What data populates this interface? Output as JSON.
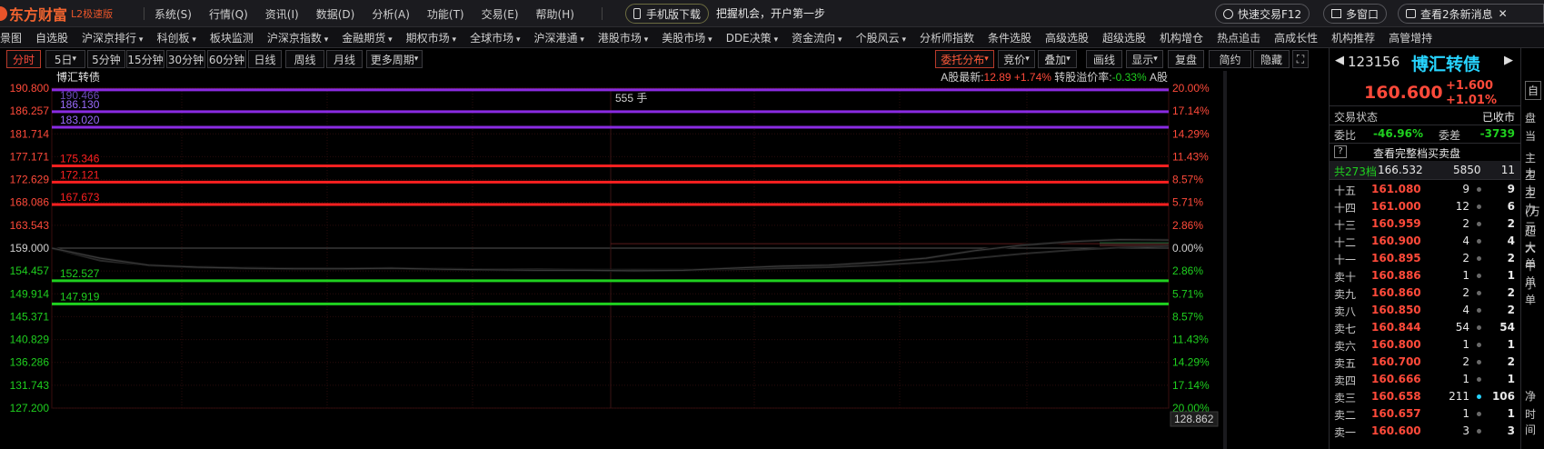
{
  "app": {
    "logo": "东方财富",
    "edition": "L2极速版",
    "menu": [
      "系统(S)",
      "行情(Q)",
      "资讯(I)",
      "数据(D)",
      "分析(A)",
      "功能(T)",
      "交易(E)",
      "帮助(H)"
    ],
    "mobile_download": "手机版下载",
    "promo": "把握机会，开户第一步",
    "fast_trade": "快速交易F12",
    "multi_window": "多窗口",
    "messages": "查看2条新消息"
  },
  "nav": [
    "景图",
    "自选股",
    "沪深京排行",
    "科创板",
    "板块监测",
    "沪深京指数",
    "金融期货",
    "期权市场",
    "全球市场",
    "沪深港通",
    "港股市场",
    "美股市场",
    "DDE决策",
    "资金流向",
    "个股风云",
    "分析师指数",
    "条件选股",
    "高级选股",
    "超级选股",
    "机构增仓",
    "热点追击",
    "高成长性",
    "机构推荐",
    "高管增持"
  ],
  "nav_dropdown": [
    false,
    false,
    true,
    true,
    false,
    true,
    true,
    true,
    true,
    true,
    true,
    true,
    true,
    true,
    true,
    false,
    false,
    false,
    false,
    false,
    false,
    false,
    false,
    false
  ],
  "toolbar": {
    "periods": [
      "分时",
      "5日",
      "5分钟",
      "15分钟",
      "30分钟",
      "60分钟",
      "日线",
      "周线",
      "月线",
      "更多周期"
    ],
    "right": [
      "委托分布",
      "竞价",
      "叠加",
      "画线",
      "显示",
      "复盘",
      "简约",
      "隐藏"
    ]
  },
  "chart_header": {
    "name": "博汇转债",
    "a_share_label": "A股最新:",
    "a_share_price": "12.89",
    "a_share_change": "+1.74%",
    "premium_label": "转股溢价率:",
    "premium": "-0.33%",
    "a_share_tag": "A股",
    "volume_note": "555 手",
    "corner_value": "128.862",
    "top_faded": "190.466"
  },
  "chart_data": {
    "type": "line",
    "ylim": [
      127.2,
      190.8
    ],
    "prev_close": 159.0,
    "y_ticks_left": [
      "190.800",
      "186.257",
      "181.714",
      "177.171",
      "172.629",
      "168.086",
      "163.543",
      "159.000",
      "154.457",
      "149.914",
      "145.371",
      "140.829",
      "136.286",
      "131.743",
      "127.200"
    ],
    "y_ticks_right": [
      "20.00%",
      "17.14%",
      "14.29%",
      "11.43%",
      "8.57%",
      "5.71%",
      "2.86%",
      "0.00%",
      "2.86%",
      "5.71%",
      "8.57%",
      "11.43%",
      "14.29%",
      "17.14%",
      "20.00%"
    ],
    "levels": [
      {
        "value": 190.466,
        "color": "#8a2be2",
        "label": ""
      },
      {
        "value": 186.13,
        "color": "#8a2be2",
        "label": "186.130"
      },
      {
        "value": 183.02,
        "color": "#8a2be2",
        "label": "183.020"
      },
      {
        "value": 175.346,
        "color": "#ff2020",
        "label": "175.346"
      },
      {
        "value": 172.121,
        "color": "#ff2020",
        "label": "172.121"
      },
      {
        "value": 167.673,
        "color": "#ff2020",
        "label": "167.673"
      },
      {
        "value": 152.527,
        "color": "#1fd01f",
        "label": "152.527"
      },
      {
        "value": 147.919,
        "color": "#1fd01f",
        "label": "147.919"
      }
    ],
    "price_line": [
      159.0,
      157.0,
      155.6,
      155.2,
      155.0,
      154.9,
      154.9,
      155.0,
      154.8,
      154.7,
      154.6,
      154.6,
      154.5,
      154.6,
      155.0,
      155.4,
      155.6,
      156.2,
      157.0,
      158.5,
      159.6,
      160.3,
      160.7,
      160.6
    ],
    "avg_line": [
      159.0,
      156.5,
      155.6,
      155.3,
      155.1,
      155.0,
      155.0,
      155.0,
      154.9,
      154.8,
      154.8,
      154.7,
      154.7,
      154.7,
      154.8,
      155.0,
      155.2,
      155.6,
      156.2,
      157.0,
      157.9,
      158.6,
      159.1,
      159.4
    ],
    "bid_marker": 160.6
  },
  "quote": {
    "code": "123156",
    "name": "博汇转债",
    "price": "160.600",
    "change": "+1.600",
    "change_pct": "+1.01%",
    "status_label": "交易状态",
    "status": "已收市",
    "wb_label": "委比",
    "wb": "-46.96%",
    "wc_label": "委差",
    "wc": "-3739",
    "full_book": "查看完整档买卖盘",
    "help": "?",
    "total_label": "共273档",
    "total_price": "166.532",
    "total_vol": "5850",
    "total_count": "11",
    "side_top": "自",
    "side_labels": [
      "盘",
      "当",
      "主力",
      "主力",
      "主力",
      "(万元",
      "超大",
      "大单",
      "中单",
      "小单",
      "净",
      "时间"
    ]
  },
  "order_book": [
    {
      "label": "十五",
      "price": "161.080",
      "vol": "9",
      "count": "9",
      "dot": "gray"
    },
    {
      "label": "十四",
      "price": "161.000",
      "vol": "12",
      "count": "6",
      "dot": "gray"
    },
    {
      "label": "十三",
      "price": "160.959",
      "vol": "2",
      "count": "2",
      "dot": "gray"
    },
    {
      "label": "十二",
      "price": "160.900",
      "vol": "4",
      "count": "4",
      "dot": "gray"
    },
    {
      "label": "十一",
      "price": "160.895",
      "vol": "2",
      "count": "2",
      "dot": "gray"
    },
    {
      "label": "卖十",
      "price": "160.886",
      "vol": "1",
      "count": "1",
      "dot": "gray"
    },
    {
      "label": "卖九",
      "price": "160.860",
      "vol": "2",
      "count": "2",
      "dot": "gray"
    },
    {
      "label": "卖八",
      "price": "160.850",
      "vol": "4",
      "count": "2",
      "dot": "gray"
    },
    {
      "label": "卖七",
      "price": "160.844",
      "vol": "54",
      "count": "54",
      "dot": "gray"
    },
    {
      "label": "卖六",
      "price": "160.800",
      "vol": "1",
      "count": "1",
      "dot": "gray"
    },
    {
      "label": "卖五",
      "price": "160.700",
      "vol": "2",
      "count": "2",
      "dot": "gray"
    },
    {
      "label": "卖四",
      "price": "160.666",
      "vol": "1",
      "count": "1",
      "dot": "gray"
    },
    {
      "label": "卖三",
      "price": "160.658",
      "vol": "211",
      "count": "106",
      "dot": "cyan"
    },
    {
      "label": "卖二",
      "price": "160.657",
      "vol": "1",
      "count": "1",
      "dot": "gray"
    },
    {
      "label": "卖一",
      "price": "160.600",
      "vol": "3",
      "count": "3",
      "dot": "gray"
    }
  ]
}
